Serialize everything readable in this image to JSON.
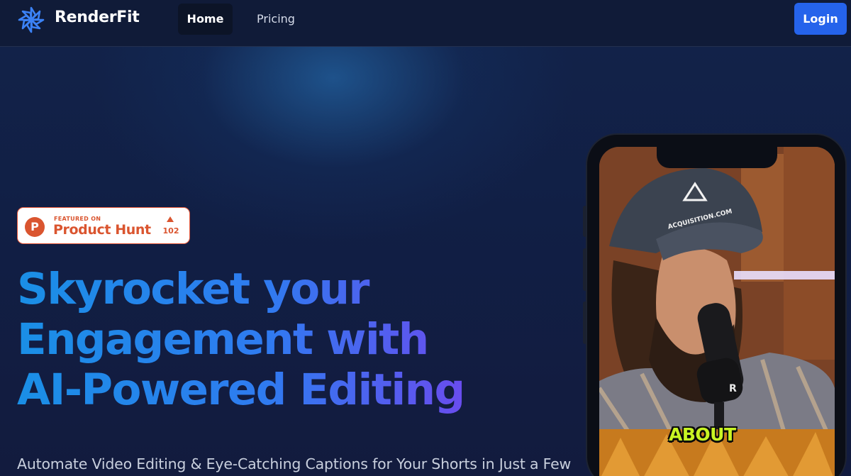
{
  "nav": {
    "brand": "RenderFit",
    "links": [
      {
        "label": "Home",
        "active": true
      },
      {
        "label": "Pricing",
        "active": false
      }
    ],
    "login_label": "Login"
  },
  "badge": {
    "featured_label": "FEATURED ON",
    "name": "Product Hunt",
    "letter": "P",
    "upvotes": "102"
  },
  "hero": {
    "headline_lines": [
      "Skyrocket your",
      "Engagement with",
      "AI-Powered Editing"
    ],
    "subtext": "Automate Video Editing & Eye-Catching Captions for Your Shorts in Just a Few"
  },
  "phone": {
    "cap_text": "ACQUISITION.COM",
    "mic_letter": "R",
    "caption_word": "ABOUT"
  },
  "colors": {
    "background": "#0f1a3a",
    "accent": "#2563eb",
    "product_hunt": "#da552f",
    "caption": "#c8f523",
    "headline_gradient": [
      "#1a8fe6",
      "#2f7bf0",
      "#7047ee"
    ]
  }
}
